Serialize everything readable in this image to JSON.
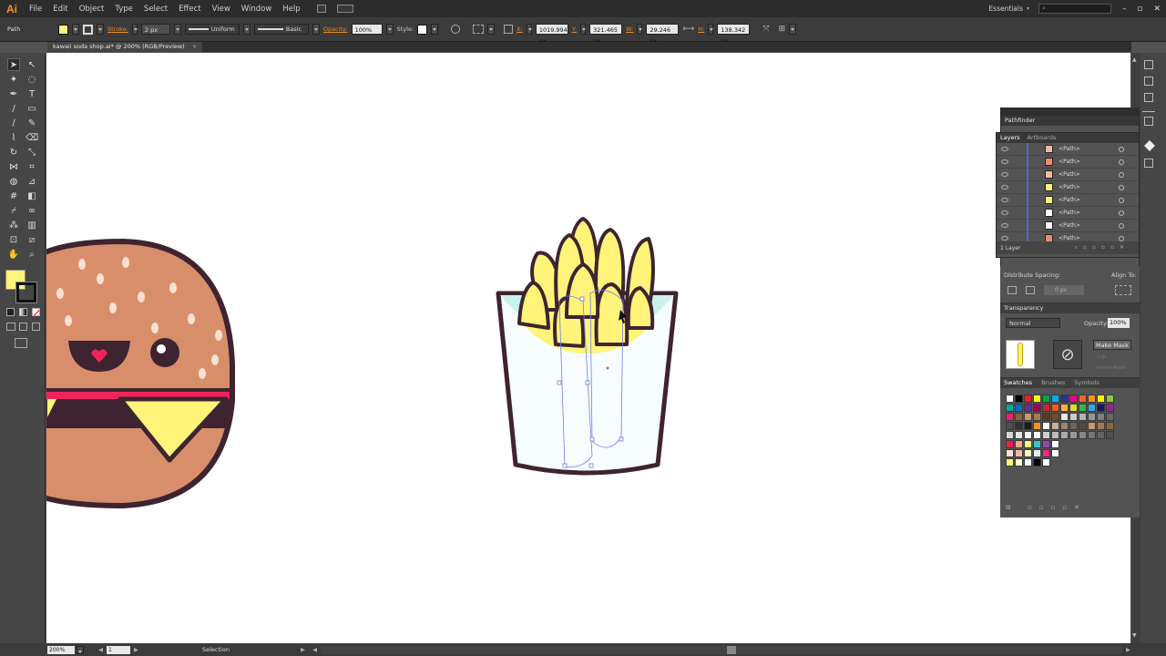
{
  "app": {
    "logo": "Ai",
    "workspace": "Essentials",
    "search_placeholder": ""
  },
  "menu": [
    "File",
    "Edit",
    "Object",
    "Type",
    "Select",
    "Effect",
    "View",
    "Window",
    "Help"
  ],
  "control_bar": {
    "selection_type": "Path",
    "stroke_label": "Stroke:",
    "stroke_weight": "2 px",
    "profile": "Uniform",
    "brush": "Basic",
    "opacity_label": "Opacity:",
    "opacity": "100%",
    "style_label": "Style:",
    "x_label": "X:",
    "x": "1019.994 px",
    "y_label": "Y:",
    "y": "321.465 px",
    "w_label": "W:",
    "w": "29.246 px",
    "h_label": "H:",
    "h": "138.342 px",
    "fill_color": "#fff37a"
  },
  "document_tab": {
    "title": "kawaii soda shop.ai* @ 200% (RGB/Preview)",
    "close": "×"
  },
  "panels": {
    "pathfinder_title": "Pathfinder",
    "layers_tabs": [
      "Layers",
      "Artboards"
    ],
    "layer_rows": [
      {
        "name": "<Path>",
        "thumb": "#f4b8a6"
      },
      {
        "name": "<Path>",
        "thumb": "#e98c6f"
      },
      {
        "name": "<Path>",
        "thumb": "#f4b8a6"
      },
      {
        "name": "<Path>",
        "thumb": "#fff27a"
      },
      {
        "name": "<Path>",
        "thumb": "#fff27a"
      },
      {
        "name": "<Path>",
        "thumb": "#ffffff"
      },
      {
        "name": "<Path>",
        "thumb": "#ffffff"
      },
      {
        "name": "<Path>",
        "thumb": "#e98c6f"
      }
    ],
    "layers_count": "1 Layer",
    "distribute_label": "Distribute Spacing:",
    "align_to_label": "Align To:",
    "spacing_value": "0 px",
    "transparency_title": "Transparency",
    "blend_mode": "Normal",
    "opacity_label": "Opacity:",
    "opacity": "100%",
    "make_mask": "Make Mask",
    "clip": "Clip",
    "invert_mask": "Invert Mask",
    "swatch_tabs": [
      "Swatches",
      "Brushes",
      "Symbols"
    ]
  },
  "swatch_colors": [
    [
      "#ffffff",
      "#000000",
      "#ed1c24",
      "#ffff00",
      "#00a651",
      "#00aeef",
      "#2e3192",
      "#ec008c",
      "#f26522",
      "#f7941d",
      "#fff200",
      "#8dc63f"
    ],
    [
      "#00a99d",
      "#0072bc",
      "#662d91",
      "#9e005d",
      "#c1272d",
      "#f15a24",
      "#fbb03b",
      "#d9e021",
      "#39b54a",
      "#29abe2",
      "#1b1464",
      "#93278f"
    ],
    [
      "#ed1e79",
      "#8c6239",
      "#c69c6d",
      "#a67c52",
      "#603813",
      "#754c24",
      "#e6e6e6",
      "#cccccc",
      "#b3b3b3",
      "#999999",
      "#808080",
      "#666666"
    ],
    [
      "#4d4d4d",
      "#333333",
      "#1a1a1a",
      "#f7931e",
      "#ffffff",
      "#c7b299",
      "#998675",
      "#736357",
      "#534741",
      "#c69c6d",
      "#a67c52",
      "#8c6239"
    ],
    [
      "#d6d6d6",
      "#e6e6e6",
      "#f2f2f2",
      "#ffffff",
      "#cfcfcf",
      "#bdbdbd",
      "#ababab",
      "#999999",
      "#878787",
      "#757575",
      "#636363",
      "#515151"
    ],
    [
      "#e8204d",
      "#f2a889",
      "#fff37a",
      "#3ac4c8",
      "#8e4db3",
      "#ffffff"
    ],
    [
      "#fde0d5",
      "#f4b8a6",
      "#fff8b8",
      "#d9f3f5",
      "#ee2a84",
      "#ffffff"
    ],
    [
      "#fff37a",
      "#fffbd0",
      "#e9ffff",
      "#000000",
      "#ffffff"
    ]
  ],
  "status": {
    "zoom": "200%",
    "artboard": "1",
    "tool": "Selection"
  }
}
